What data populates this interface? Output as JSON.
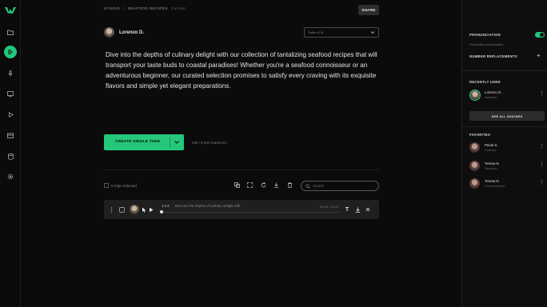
{
  "colors": {
    "accent": "#25c77a",
    "background": "#0b0b0b",
    "panel": "#0e0e0e"
  },
  "rail": {
    "icons": [
      "logo-icon",
      "folder-icon",
      "text-to-speech-icon",
      "microphone-icon",
      "dubbing-icon",
      "video-icon",
      "voice-library-icon",
      "database-icon",
      "settings-icon"
    ]
  },
  "topbar": {
    "crumbs": [
      "STUDIO",
      "SEAFOOD RECIPES",
      "Current"
    ],
    "share_label": "SHARE"
  },
  "editor": {
    "voice_name": "Lorenzo D.",
    "model_select": "Turbo v2.5",
    "text": "Dive into the depths of culinary delight with our collection of tantalizing seafood recipes that will transport your taste buds to coastal paradises! Whether you're a seafood connoisseur or an adventurous beginner, our curated selection promises to satisfy every craving with its exquisite flavors and simple yet elegant preparations.",
    "create_label": "CREATE SINGLE TAKE",
    "char_count": "336 / 5,000 characters"
  },
  "toolbar": {
    "clips_selected": "0 Clips Selected",
    "search_placeholder": "Search"
  },
  "clip": {
    "time": "1.2.4",
    "text": "Dive into the depths of culinary delight with",
    "duration": "00:00 / 00:00"
  },
  "panel": {
    "pronunciation_title": "PRONUNCIATION",
    "pronunciation_sub": "Overwrite pronunciation",
    "replacements_title": "NUMBER REPLACEMENTS",
    "recently_used_title": "RECENTLY USED",
    "recent": [
      {
        "name": "Lorenzo D.",
        "sub": "Narration"
      }
    ],
    "see_all_label": "SEE ALL AVATARS",
    "favorites_title": "FAVORITES",
    "favorites": [
      {
        "name": "Paola S.",
        "sub": "Podcast"
      },
      {
        "name": "Teresa N.",
        "sub": "Narration"
      },
      {
        "name": "Teresa N.",
        "sub": "Conversational"
      }
    ]
  }
}
